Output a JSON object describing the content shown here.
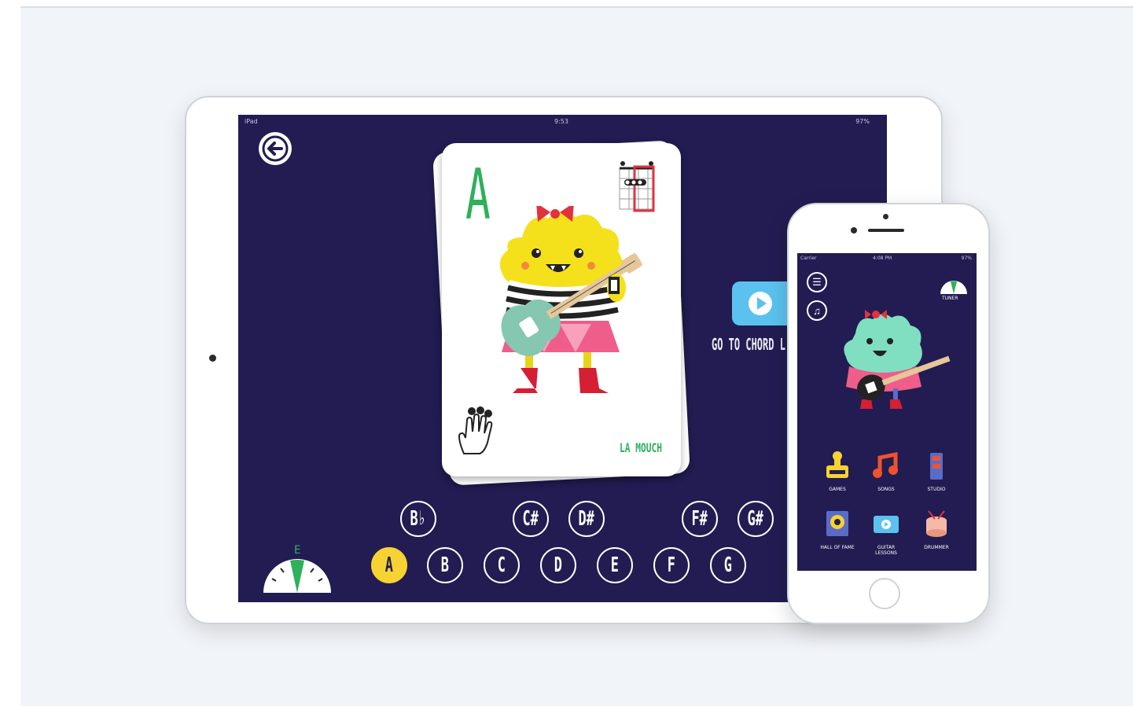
{
  "ipad": {
    "status": {
      "carrier": "iPad",
      "time": "9:53",
      "battery": "97%"
    },
    "card": {
      "chord": "A",
      "monster_name": "LA MOUCH"
    },
    "goto_label": "GO TO CHORD L",
    "sharps": [
      "B♭",
      "C#",
      "D#",
      "F#",
      "G#"
    ],
    "naturals": [
      "A",
      "B",
      "C",
      "D",
      "E",
      "F",
      "G"
    ],
    "selected_note": "A",
    "tuner_note": "E"
  },
  "iphone": {
    "status": {
      "carrier": "Carrier",
      "time": "4:08 PM",
      "battery": "97%"
    },
    "tuner_label": "TUNER",
    "menu": [
      {
        "label": "GAMES",
        "icon": "game-icon"
      },
      {
        "label": "SONGS",
        "icon": "music-note-icon"
      },
      {
        "label": "STUDIO",
        "icon": "studio-icon"
      },
      {
        "label": "HALL OF FAME",
        "icon": "trophy-icon"
      },
      {
        "label": "GUITAR LESSONS",
        "icon": "video-icon"
      },
      {
        "label": "DRUMMER",
        "icon": "drum-icon"
      }
    ]
  },
  "colors": {
    "screen": "#221c52",
    "accent_yellow": "#f6d330",
    "card_green": "#2fb05a",
    "play_blue": "#5bc2ef"
  }
}
